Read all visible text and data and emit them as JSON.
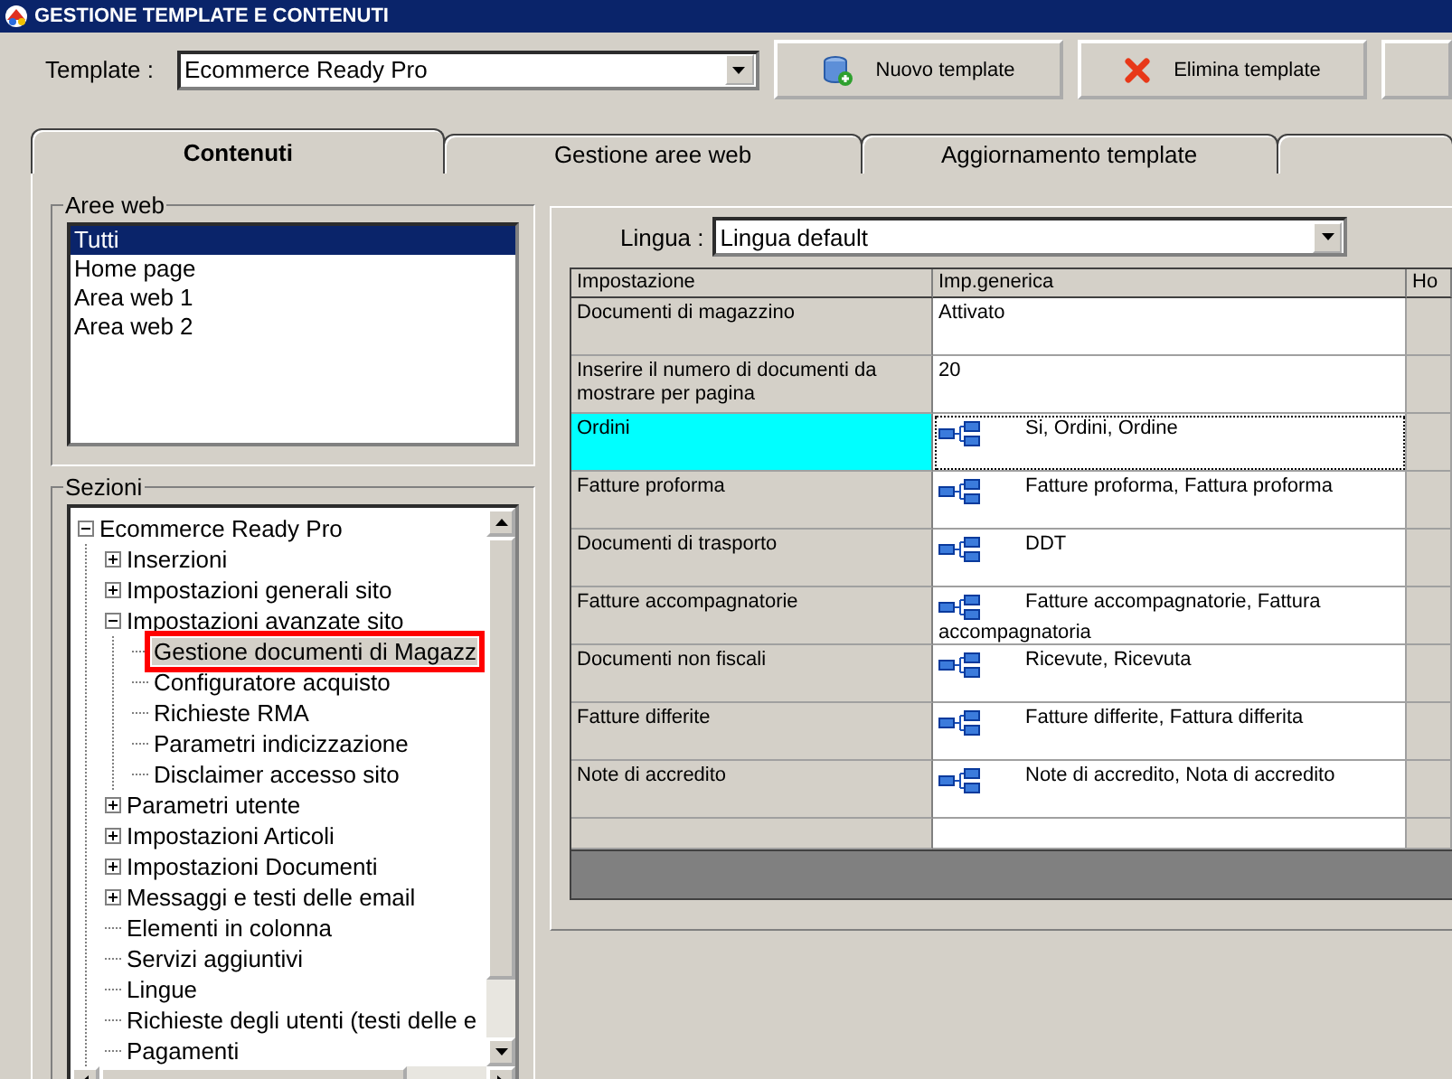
{
  "window": {
    "title": "GESTIONE TEMPLATE E CONTENUTI"
  },
  "toolbar": {
    "template_label": "Template :",
    "template_value": "Ecommerce Ready Pro",
    "buttons": [
      {
        "kind": "new",
        "label": "Nuovo template"
      },
      {
        "kind": "delete",
        "label": "Elimina template"
      }
    ]
  },
  "tabs": [
    {
      "label": "Contenuti",
      "selected": true
    },
    {
      "label": "Gestione aree web",
      "selected": false
    },
    {
      "label": "Aggiornamento template",
      "selected": false
    }
  ],
  "aree_web": {
    "title": "Aree web",
    "items": [
      {
        "label": "Tutti",
        "selected": true
      },
      {
        "label": "Home page",
        "selected": false
      },
      {
        "label": "Area web 1",
        "selected": false
      },
      {
        "label": "Area web 2",
        "selected": false
      }
    ]
  },
  "sezioni": {
    "title": "Sezioni",
    "tree": [
      {
        "label": "Ecommerce Ready Pro",
        "expanded": true,
        "selected": false,
        "children": [
          {
            "label": "Inserzioni",
            "expanded": false,
            "selected": false
          },
          {
            "label": "Impostazioni generali sito",
            "expanded": false,
            "selected": false
          },
          {
            "label": "Impostazioni avanzate sito",
            "expanded": true,
            "selected": false,
            "children": [
              {
                "label": "Gestione documenti di Magazz",
                "selected": true
              },
              {
                "label": "Configuratore acquisto",
                "selected": false
              },
              {
                "label": "Richieste RMA",
                "selected": false
              },
              {
                "label": "Parametri indicizzazione",
                "selected": false
              },
              {
                "label": "Disclaimer accesso sito",
                "selected": false
              }
            ]
          },
          {
            "label": "Parametri utente",
            "expanded": false,
            "selected": false
          },
          {
            "label": "Impostazioni Articoli",
            "expanded": false,
            "selected": false
          },
          {
            "label": "Impostazioni Documenti",
            "expanded": false,
            "selected": false
          },
          {
            "label": "Messaggi e testi delle email",
            "expanded": false,
            "selected": false
          },
          {
            "label": "Elementi in colonna",
            "selected": false
          },
          {
            "label": "Servizi aggiuntivi",
            "selected": false
          },
          {
            "label": "Lingue",
            "selected": false
          },
          {
            "label": "Richieste degli utenti (testi delle e",
            "selected": false
          },
          {
            "label": "Pagamenti",
            "selected": false
          }
        ]
      }
    ]
  },
  "lingua": {
    "label": "Lingua :",
    "value": "Lingua default"
  },
  "table": {
    "columns": [
      "Impostazione",
      "Imp.generica",
      "Ho"
    ],
    "rows": [
      {
        "setting": "Documenti di magazzino",
        "kind": "text",
        "value": "Attivato",
        "selected": false
      },
      {
        "setting": "Inserire il numero di documenti da mostrare per pagina",
        "kind": "text",
        "value": "20",
        "selected": false
      },
      {
        "setting": "Ordini",
        "kind": "tree",
        "value": "Si, Ordini, Ordine",
        "selected": true
      },
      {
        "setting": "Fatture proforma",
        "kind": "tree",
        "value": "Fatture proforma, Fattura proforma",
        "selected": false
      },
      {
        "setting": "Documenti di trasporto",
        "kind": "tree",
        "value": "DDT",
        "selected": false
      },
      {
        "setting": "Fatture accompagnatorie",
        "kind": "tree",
        "value": "Fatture accompagnatorie, Fattura accompagnatoria",
        "selected": false
      },
      {
        "setting": "Documenti non fiscali",
        "kind": "tree",
        "value": "Ricevute, Ricevuta",
        "selected": false
      },
      {
        "setting": "Fatture differite",
        "kind": "tree",
        "value": "Fatture differite, Fattura differita",
        "selected": false
      },
      {
        "setting": "Note di accredito",
        "kind": "tree",
        "value": "Note di accredito, Nota di accredito",
        "selected": false
      }
    ]
  }
}
